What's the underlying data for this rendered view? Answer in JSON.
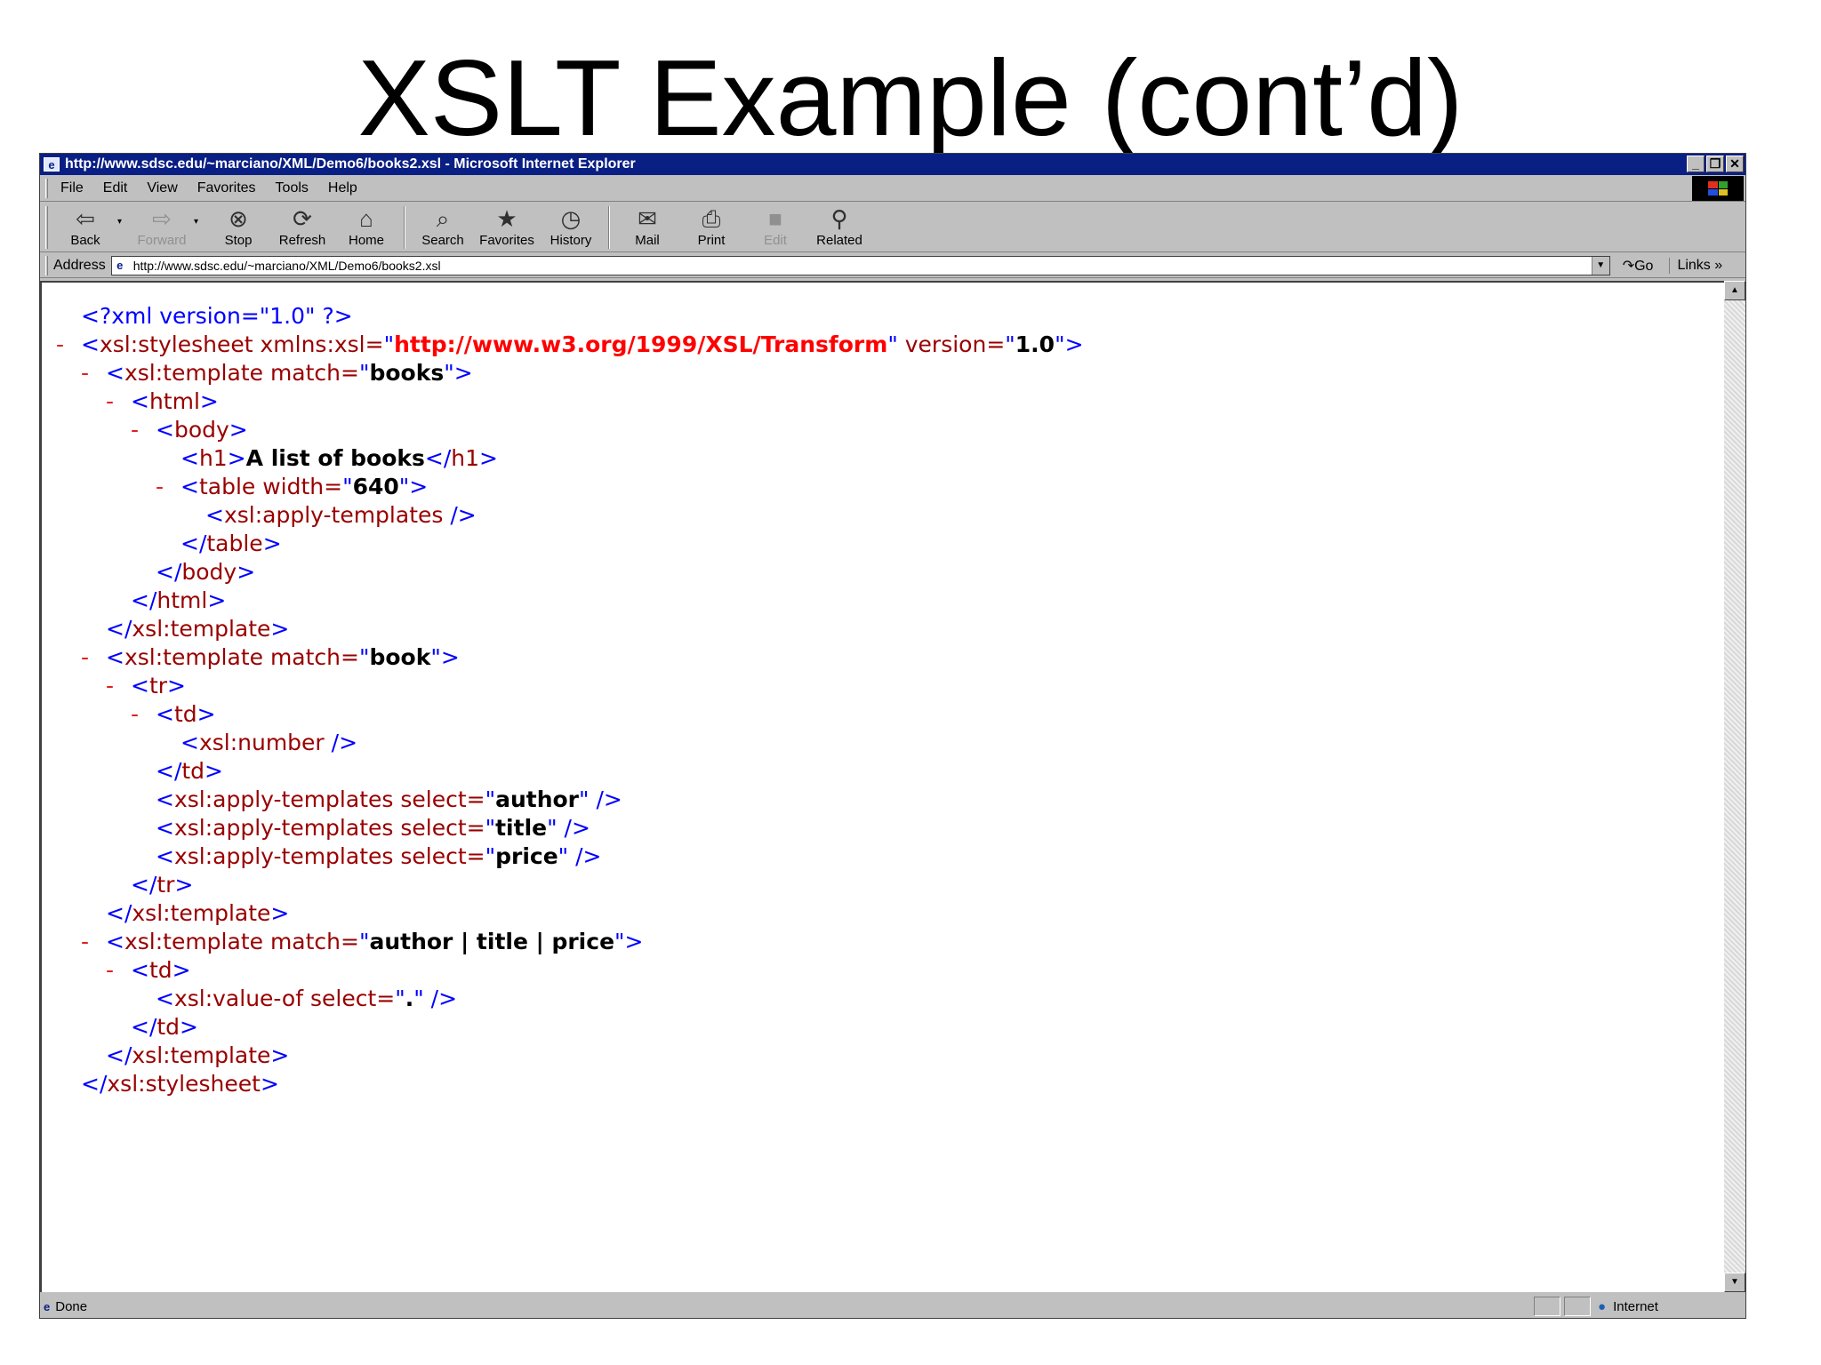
{
  "slide_title": "XSLT Example (cont’d)",
  "window": {
    "title": "http://www.sdsc.edu/~marciano/XML/Demo6/books2.xsl - Microsoft Internet Explorer",
    "minimize": "_",
    "restore": "❐",
    "close": "✕"
  },
  "menu": [
    "File",
    "Edit",
    "View",
    "Favorites",
    "Tools",
    "Help"
  ],
  "toolbar": {
    "back": {
      "label": "Back",
      "icon": "back-arrow-icon"
    },
    "forward": {
      "label": "Forward",
      "icon": "forward-arrow-icon"
    },
    "stop": {
      "label": "Stop",
      "icon": "stop-icon"
    },
    "refresh": {
      "label": "Refresh",
      "icon": "refresh-icon"
    },
    "home": {
      "label": "Home",
      "icon": "home-icon"
    },
    "search": {
      "label": "Search",
      "icon": "search-icon"
    },
    "favorites": {
      "label": "Favorites",
      "icon": "favorites-icon"
    },
    "history": {
      "label": "History",
      "icon": "history-icon"
    },
    "mail": {
      "label": "Mail",
      "icon": "mail-icon"
    },
    "print": {
      "label": "Print",
      "icon": "print-icon"
    },
    "edit": {
      "label": "Edit",
      "icon": "edit-icon"
    },
    "related": {
      "label": "Related",
      "icon": "related-icon"
    }
  },
  "address": {
    "label": "Address",
    "value": "http://www.sdsc.edu/~marciano/XML/Demo6/books2.xsl",
    "go": "Go",
    "links": "Links"
  },
  "xml_lines": [
    {
      "pi": "<?xml version=\"1.0\" ?>"
    },
    {
      "open_a": "<",
      "tag": "xsl:stylesheet",
      "attr": " xmlns:xsl=",
      "q1": "\"",
      "val": "http://www.w3.org/1999/XSL/Transform",
      "q2": "\"",
      "attr2": " version=",
      "q3": "\"",
      "val2": "1.0",
      "q4": "\"",
      "close": ">"
    },
    {
      "open_a": "<",
      "tag": "xsl:template",
      "attr": " match=",
      "q1": "\"",
      "val": "books",
      "q2": "\"",
      "close": ">"
    },
    {
      "open_a": "<",
      "tag": "html",
      "close": ">"
    },
    {
      "open_a": "<",
      "tag": "body",
      "close": ">"
    },
    {
      "open_a": "<",
      "tag": "h1",
      "close": ">",
      "text": "A list of books",
      "end_open": "</",
      "end_tag": "h1",
      "end_close": ">"
    },
    {
      "open_a": "<",
      "tag": "table",
      "attr": " width=",
      "q1": "\"",
      "val": "640",
      "q2": "\"",
      "close": ">"
    },
    {
      "open_a": "<",
      "tag": "xsl:apply-templates",
      "close": " />"
    },
    {
      "open_a": "</",
      "tag": "table",
      "close": ">"
    },
    {
      "open_a": "</",
      "tag": "body",
      "close": ">"
    },
    {
      "open_a": "</",
      "tag": "html",
      "close": ">"
    },
    {
      "open_a": "</",
      "tag": "xsl:template",
      "close": ">"
    },
    {
      "open_a": "<",
      "tag": "xsl:template",
      "attr": " match=",
      "q1": "\"",
      "val": "book",
      "q2": "\"",
      "close": ">"
    },
    {
      "open_a": "<",
      "tag": "tr",
      "close": ">"
    },
    {
      "open_a": "<",
      "tag": "td",
      "close": ">"
    },
    {
      "open_a": "<",
      "tag": "xsl:number",
      "close": " />"
    },
    {
      "open_a": "</",
      "tag": "td",
      "close": ">"
    },
    {
      "open_a": "<",
      "tag": "xsl:apply-templates",
      "attr": " select=",
      "q1": "\"",
      "val": "author",
      "q2": "\"",
      "close": " />"
    },
    {
      "open_a": "<",
      "tag": "xsl:apply-templates",
      "attr": " select=",
      "q1": "\"",
      "val": "title",
      "q2": "\"",
      "close": " />"
    },
    {
      "open_a": "<",
      "tag": "xsl:apply-templates",
      "attr": " select=",
      "q1": "\"",
      "val": "price",
      "q2": "\"",
      "close": " />"
    },
    {
      "open_a": "</",
      "tag": "tr",
      "close": ">"
    },
    {
      "open_a": "</",
      "tag": "xsl:template",
      "close": ">"
    },
    {
      "open_a": "<",
      "tag": "xsl:template",
      "attr": " match=",
      "q1": "\"",
      "val": "author | title | price",
      "q2": "\"",
      "close": ">"
    },
    {
      "open_a": "<",
      "tag": "td",
      "close": ">"
    },
    {
      "open_a": "<",
      "tag": "xsl:value-of",
      "attr": " select=",
      "q1": "\"",
      "val": ".",
      "q2": "\"",
      "close": " />"
    },
    {
      "open_a": "</",
      "tag": "td",
      "close": ">"
    },
    {
      "open_a": "</",
      "tag": "xsl:template",
      "close": ">"
    },
    {
      "open_a": "</",
      "tag": "xsl:stylesheet",
      "close": ">"
    }
  ],
  "collapse_marker": "-",
  "status": {
    "text": "Done",
    "zone": "Internet"
  }
}
